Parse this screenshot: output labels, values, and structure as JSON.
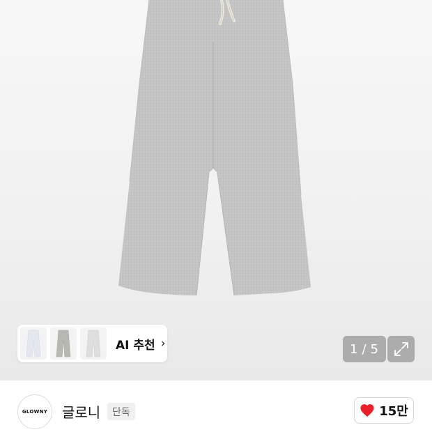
{
  "gallery": {
    "page_current": "1",
    "page_total": "5",
    "page_separator": "/",
    "colors": {
      "pants_gray": "#c6c6c6",
      "drawstring": "#ece9dd"
    }
  },
  "ai_recommend": {
    "label": "AI 추천",
    "chevron": "›",
    "thumbnails": [
      {
        "name": "white-pants",
        "color": "#e4e7f0"
      },
      {
        "name": "gray-pants",
        "color": "#b8b8b2"
      },
      {
        "name": "light-gray-pants",
        "color": "#dedede"
      }
    ]
  },
  "brand": {
    "logo_text": "GLOWNY",
    "name": "글로니",
    "badge": "단독"
  },
  "like": {
    "icon": "heart-icon",
    "count": "15만",
    "color": "#e8202a"
  }
}
